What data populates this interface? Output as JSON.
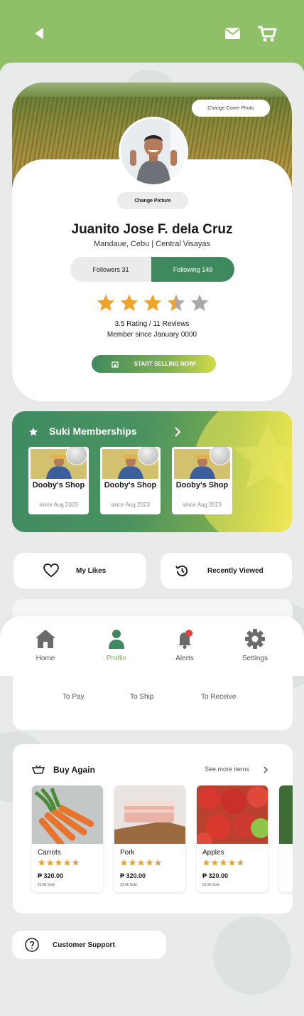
{
  "topbar": {
    "back_icon": "back-arrow-icon",
    "mail_icon": "mail-icon",
    "cart_icon": "cart-icon"
  },
  "profile": {
    "change_cover_label": "Change Cover Photo",
    "change_picture_label": "Change Picture",
    "name": "Juanito Jose F. dela Cruz",
    "location": "Mandaue, Cebu | Central Visayas",
    "followers_label": "Followers  31",
    "following_label": "Following 149",
    "rating": 3.5,
    "rating_text": "3.5 Rating / 11 Reviews",
    "member_since": "Member since January 0000",
    "sell_button_label": "START SELLING NOW!"
  },
  "suki": {
    "title": "Suki Memberships",
    "shops": [
      {
        "name": "Dooby's Shop",
        "since": "since Aug 2023"
      },
      {
        "name": "Dooby's Shop",
        "since": "since Aug 2023"
      },
      {
        "name": "Dooby's Shop",
        "since": "since Aug 2023"
      }
    ]
  },
  "quick_links": {
    "likes_label": "My Likes",
    "recent_label": "Recently Viewed"
  },
  "nav": {
    "items": [
      {
        "label": "Home",
        "icon": "home-icon"
      },
      {
        "label": "Profile",
        "icon": "profile-icon",
        "active": true
      },
      {
        "label": "Alerts",
        "icon": "bell-icon"
      },
      {
        "label": "Settings",
        "icon": "gear-icon"
      }
    ],
    "active_color": "#7fb04f"
  },
  "orders": {
    "to_pay": "To Pay",
    "to_ship": "To Ship",
    "to_receive": "To Receive"
  },
  "buy_again": {
    "title": "Buy Again",
    "see_more_label": "See more items",
    "products": [
      {
        "name": "Carrots",
        "price": "₱ 320.00",
        "sold": "23.9k Sold",
        "rating": 4.5
      },
      {
        "name": "Pork",
        "price": "₱ 320.00",
        "sold": "23.9k Sold",
        "rating": 4.5
      },
      {
        "name": "Apples",
        "price": "₱ 320.00",
        "sold": "23.9k Sold",
        "rating": 4.5
      }
    ]
  },
  "support": {
    "label": "Customer Support"
  },
  "colors": {
    "brand_green": "#3e8a5e",
    "topbar": "#8fbf67",
    "star": "#f0a329"
  }
}
